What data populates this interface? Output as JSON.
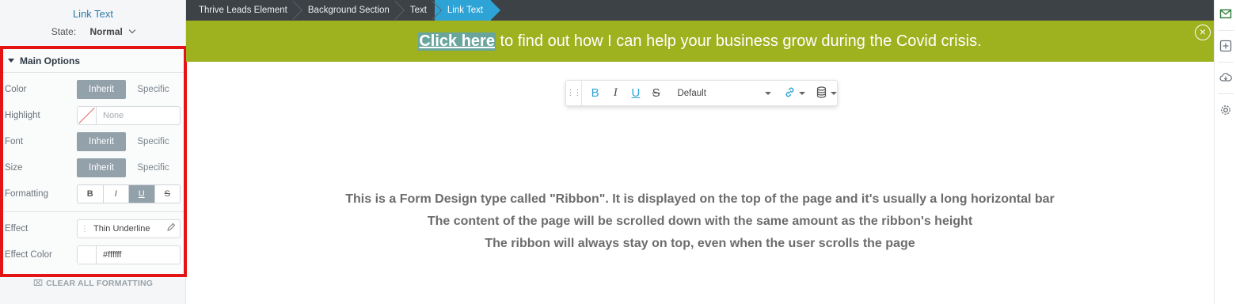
{
  "left_panel": {
    "title": "Link Text",
    "state_label": "State:",
    "state_value": "Normal",
    "main_options": {
      "header": "Main Options",
      "color": {
        "label": "Color",
        "on": "Inherit",
        "off": "Specific"
      },
      "highlight": {
        "label": "Highlight",
        "value": "None"
      },
      "font": {
        "label": "Font",
        "on": "Inherit",
        "off": "Specific"
      },
      "size": {
        "label": "Size",
        "on": "Inherit",
        "off": "Specific"
      },
      "formatting": {
        "label": "Formatting",
        "bold": "B",
        "italic": "I",
        "underline": "U",
        "strike": "S"
      },
      "effect": {
        "label": "Effect",
        "value": "Thin Underline"
      },
      "effect_color": {
        "label": "Effect Color",
        "value": "#ffffff"
      }
    },
    "clear_all": "CLEAR ALL FORMATTING"
  },
  "breadcrumb": [
    "Thrive Leads Element",
    "Background Section",
    "Text",
    "Link Text"
  ],
  "ribbon": {
    "link_text": "Click here",
    "rest_text": " to find out how I can help your business grow during the Covid crisis."
  },
  "toolbar": {
    "bold": "B",
    "italic": "I",
    "underline": "U",
    "strike": "S",
    "font_value": "Default"
  },
  "description": {
    "line1": "This is a Form Design type called \"Ribbon\". It is displayed on the top of the page and it's usually a long horizontal bar",
    "line2": "The content of the page will be scrolled down with the same amount as the ribbon's height",
    "line3": "The ribbon will always stay on top, even when the user scrolls the page"
  },
  "colors": {
    "ribbon_bg": "#9eb11f",
    "accent": "#2ea3d6",
    "highlight_box": "#e51414"
  },
  "icons": {
    "close": "close-icon",
    "right_rail": [
      "envelope-icon",
      "add-icon",
      "cloud-download-icon",
      "gear-icon"
    ]
  }
}
